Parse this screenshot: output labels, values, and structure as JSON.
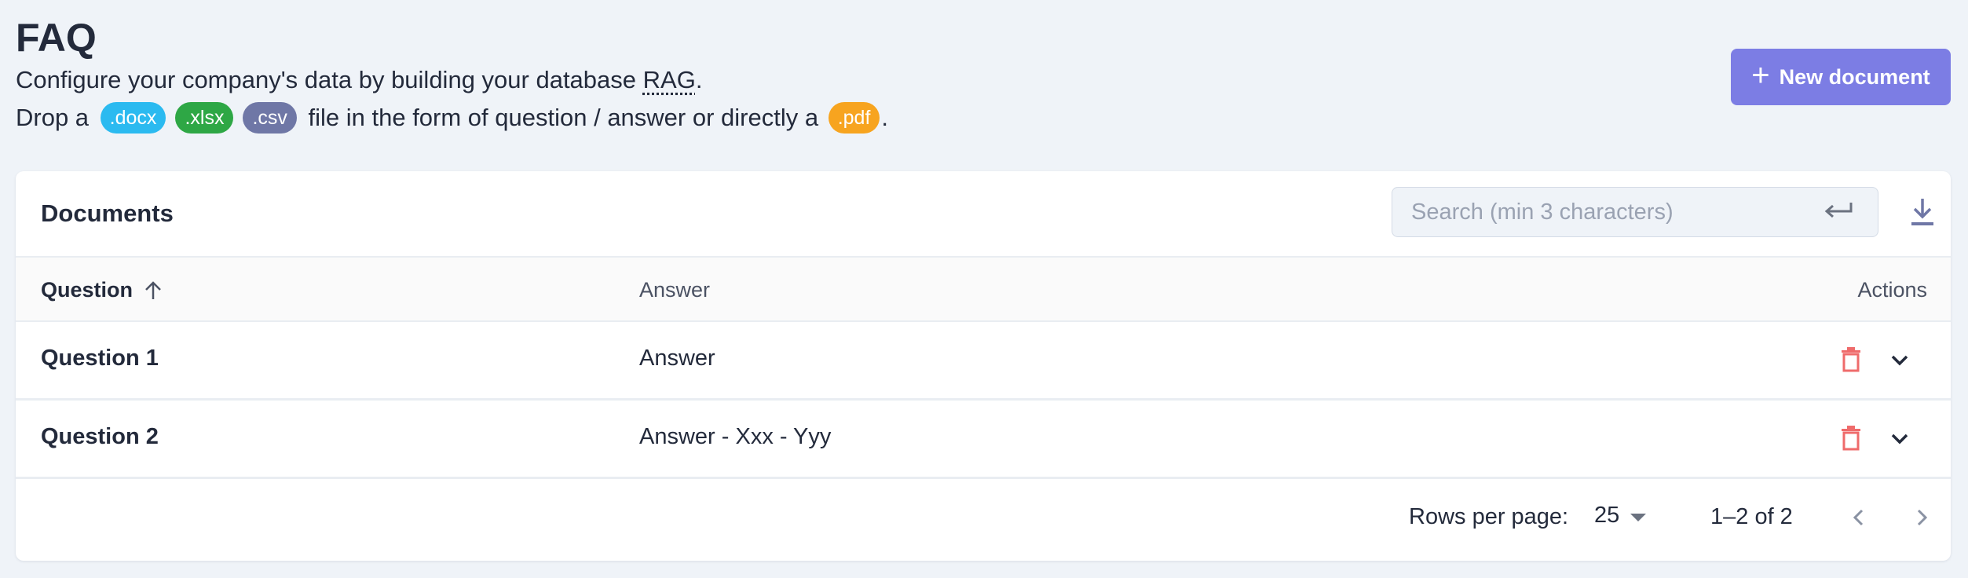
{
  "page": {
    "title": "FAQ",
    "description_line1_pre": "Configure your company's data by building your database ",
    "description_line1_abbr": "RAG",
    "description_line1_post": ".",
    "description_line2_pre": "Drop a ",
    "chips": {
      "docx": ".docx",
      "xlsx": ".xlsx",
      "csv": ".csv",
      "pdf": ".pdf"
    },
    "description_line2_mid": " file in the form of question / answer or directly a ",
    "description_line2_post": "."
  },
  "new_document_button": {
    "icon": "plus-icon",
    "label": "New document"
  },
  "documents": {
    "title": "Documents",
    "search": {
      "placeholder": "Search (min 3 characters)",
      "value": "",
      "icon": "enter-icon"
    },
    "download_icon": "download-icon",
    "columns": {
      "question": "Question",
      "answer": "Answer",
      "actions": "Actions"
    },
    "sort": {
      "column": "question",
      "direction": "asc",
      "icon": "arrow-up-icon"
    },
    "rows": [
      {
        "question": "Question 1",
        "answer": "Answer"
      },
      {
        "question": "Question 2",
        "answer": "Answer - Xxx - Yyy"
      }
    ],
    "footer": {
      "rows_per_page_label": "Rows per page:",
      "rows_per_page_value": "25",
      "range": "1–2 of 2"
    }
  },
  "colors": {
    "background": "#eff3f8",
    "primary": "#7c7de4",
    "delete": "#ef6b6b",
    "chip_docx": "#2bbaf0",
    "chip_xlsx": "#2ea745",
    "chip_csv": "#6f77a6",
    "chip_pdf": "#f7a41f"
  }
}
